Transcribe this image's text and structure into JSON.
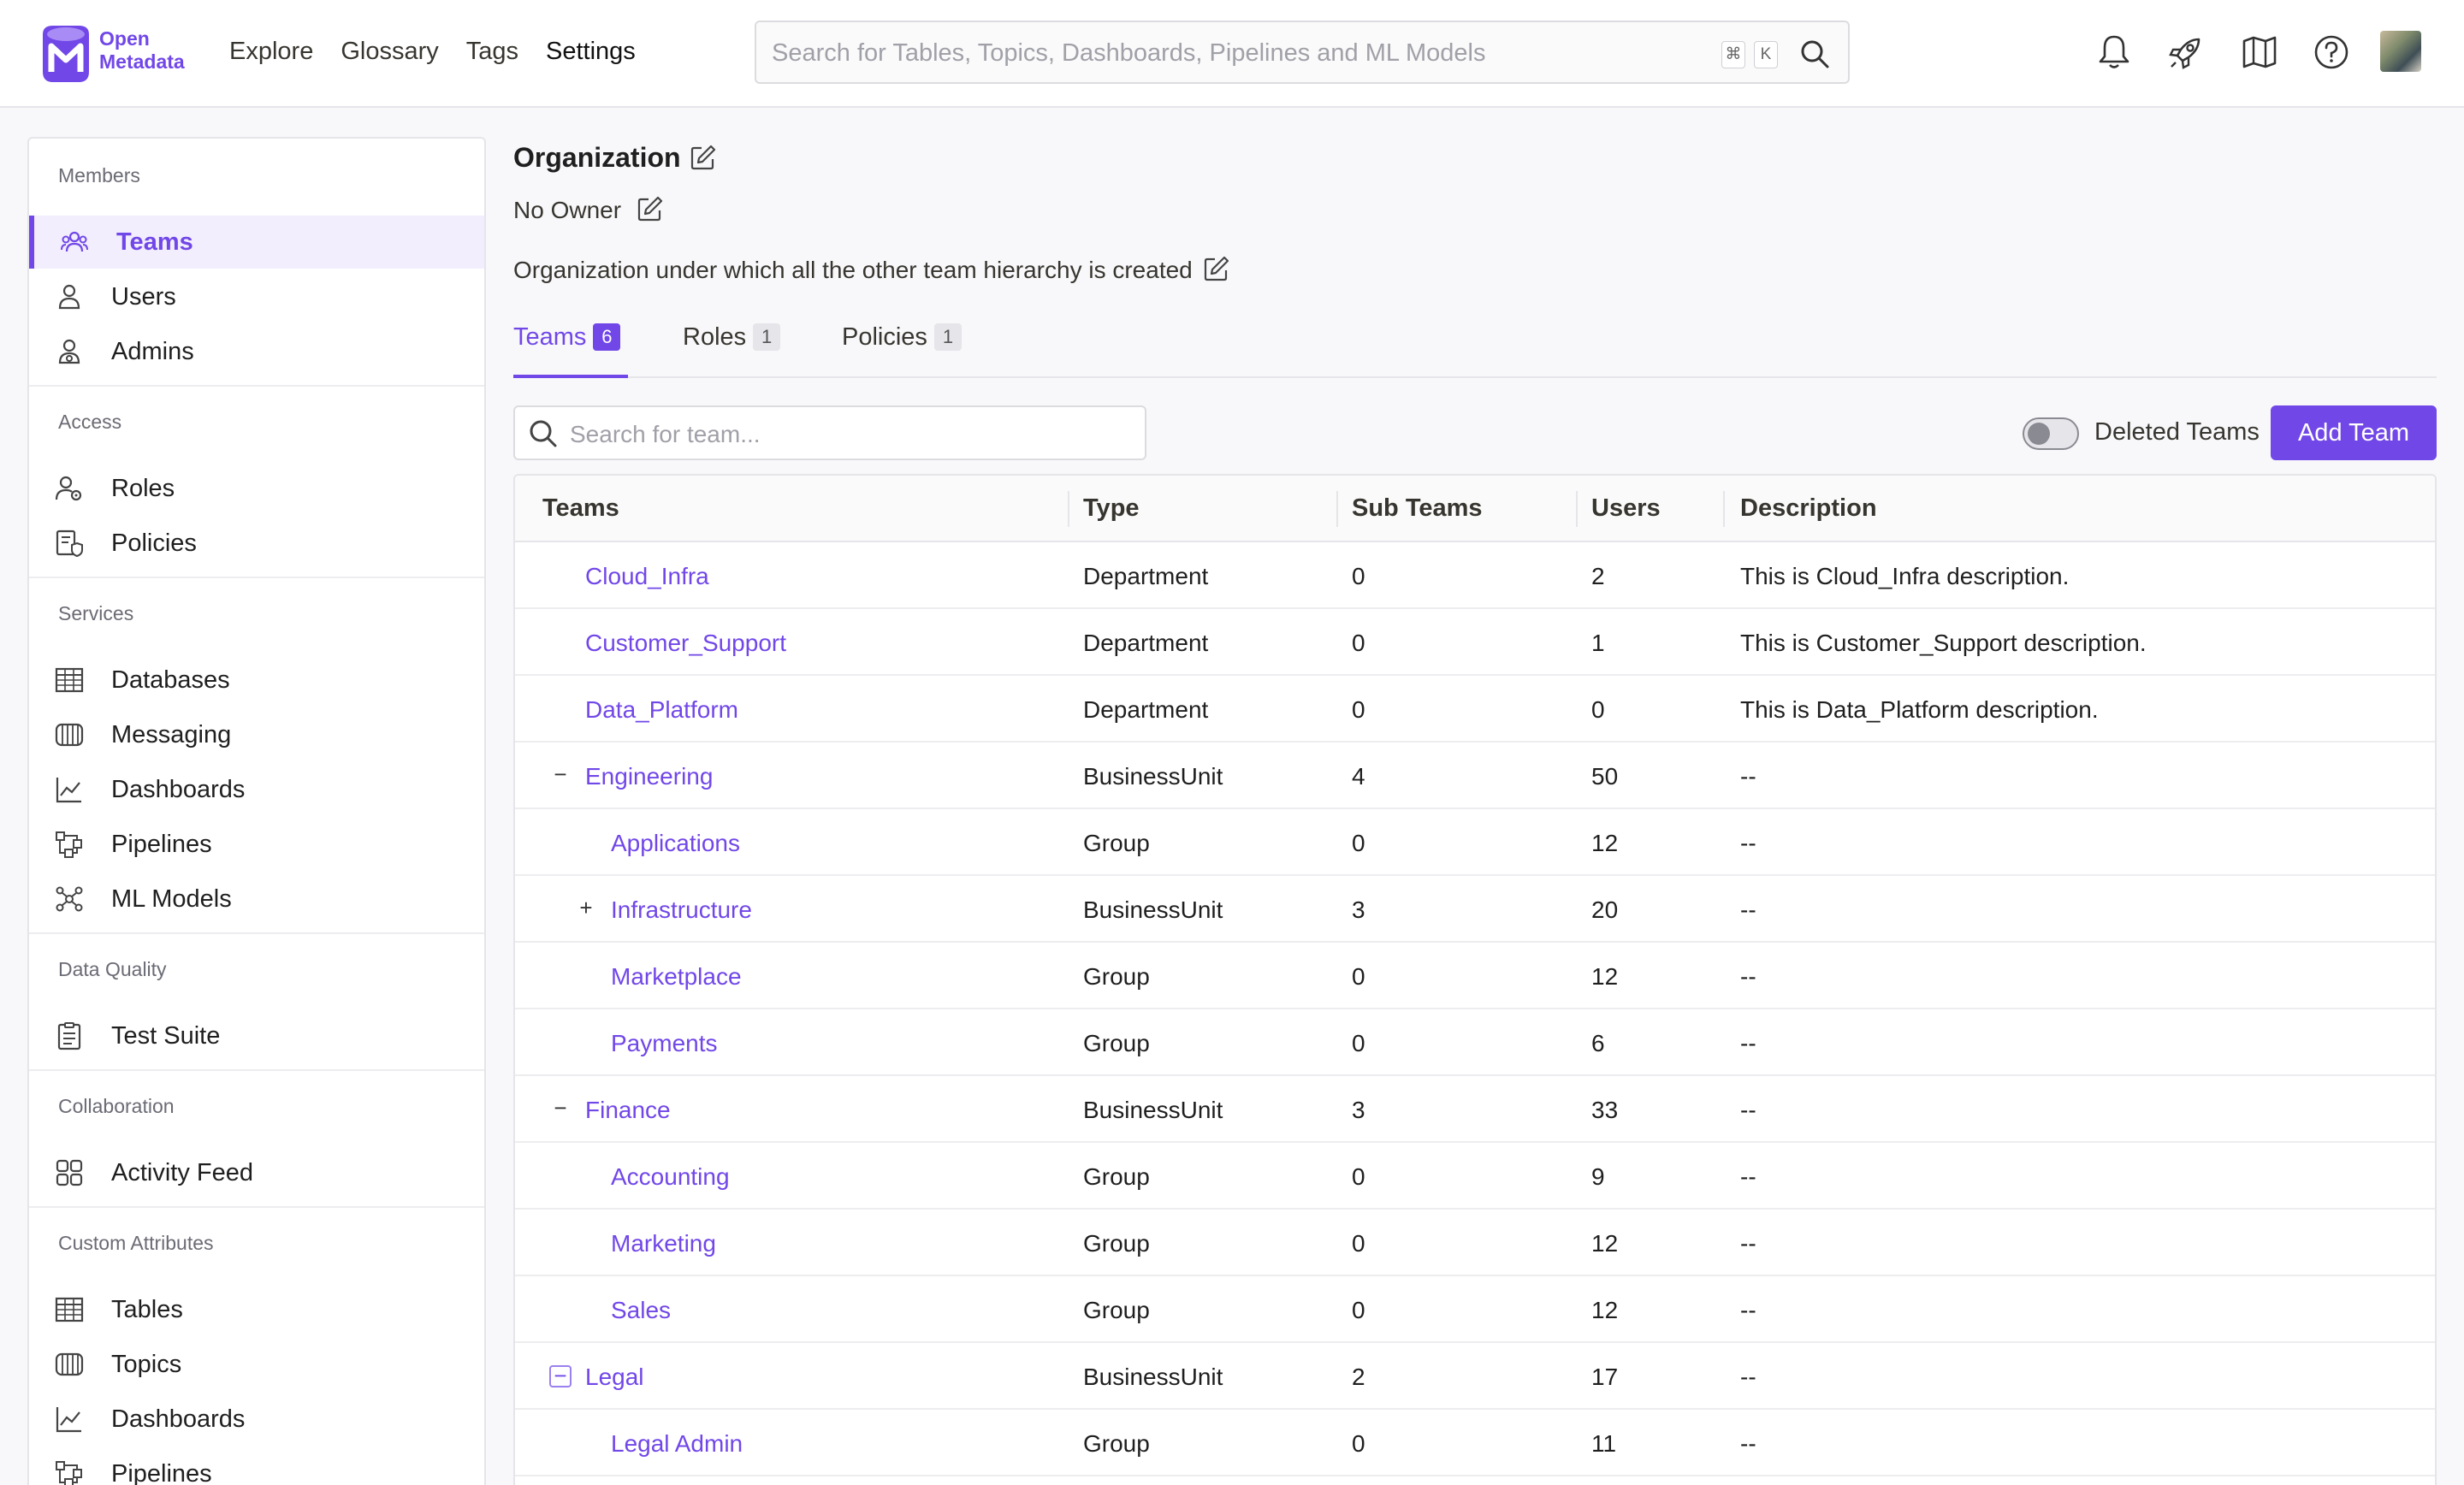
{
  "brand": {
    "line1": "Open",
    "line2": "Metadata",
    "color": "#7147e8"
  },
  "nav": [
    {
      "label": "Explore"
    },
    {
      "label": "Glossary"
    },
    {
      "label": "Tags"
    },
    {
      "label": "Settings"
    }
  ],
  "search": {
    "placeholder": "Search for Tables, Topics, Dashboards, Pipelines and ML Models",
    "shortcut_cmd": "⌘",
    "shortcut_key": "K"
  },
  "top_icons": [
    "bell-icon",
    "rocket-icon",
    "map-icon",
    "help-icon"
  ],
  "sidebar": {
    "sections": [
      {
        "title": "Members",
        "items": [
          {
            "label": "Teams",
            "icon": "teams-icon",
            "active": true
          },
          {
            "label": "Users",
            "icon": "user-icon"
          },
          {
            "label": "Admins",
            "icon": "admin-icon"
          }
        ]
      },
      {
        "title": "Access",
        "items": [
          {
            "label": "Roles",
            "icon": "roles-icon"
          },
          {
            "label": "Policies",
            "icon": "policies-icon"
          }
        ]
      },
      {
        "title": "Services",
        "items": [
          {
            "label": "Databases",
            "icon": "table-icon"
          },
          {
            "label": "Messaging",
            "icon": "topic-icon"
          },
          {
            "label": "Dashboards",
            "icon": "chart-icon"
          },
          {
            "label": "Pipelines",
            "icon": "pipeline-icon"
          },
          {
            "label": "ML Models",
            "icon": "mlmodel-icon"
          }
        ]
      },
      {
        "title": "Data Quality",
        "items": [
          {
            "label": "Test Suite",
            "icon": "testsuite-icon"
          }
        ]
      },
      {
        "title": "Collaboration",
        "items": [
          {
            "label": "Activity Feed",
            "icon": "feed-icon"
          }
        ]
      },
      {
        "title": "Custom Attributes",
        "items": [
          {
            "label": "Tables",
            "icon": "table-icon"
          },
          {
            "label": "Topics",
            "icon": "topic-icon"
          },
          {
            "label": "Dashboards",
            "icon": "chart-icon"
          },
          {
            "label": "Pipelines",
            "icon": "pipeline-icon"
          }
        ]
      }
    ]
  },
  "page": {
    "title": "Organization",
    "owner": "No Owner",
    "description": "Organization under which all the other team hierarchy is created"
  },
  "tabs": [
    {
      "label": "Teams",
      "count": "6",
      "active": true
    },
    {
      "label": "Roles",
      "count": "1"
    },
    {
      "label": "Policies",
      "count": "1"
    }
  ],
  "toolbar": {
    "search_placeholder": "Search for team...",
    "deleted_label": "Deleted Teams",
    "add_label": "Add Team"
  },
  "table": {
    "columns": [
      "Teams",
      "Type",
      "Sub Teams",
      "Users",
      "Description"
    ],
    "rows": [
      {
        "name": "Cloud_Infra",
        "type": "Department",
        "sub": "0",
        "users": "2",
        "desc": "This is Cloud_Infra description.",
        "level": 0,
        "expander": ""
      },
      {
        "name": "Customer_Support",
        "type": "Department",
        "sub": "0",
        "users": "1",
        "desc": "This is Customer_Support description.",
        "level": 0,
        "expander": ""
      },
      {
        "name": "Data_Platform",
        "type": "Department",
        "sub": "0",
        "users": "0",
        "desc": "This is Data_Platform description.",
        "level": 0,
        "expander": ""
      },
      {
        "name": "Engineering",
        "type": "BusinessUnit",
        "sub": "4",
        "users": "50",
        "desc": "--",
        "level": 0,
        "expander": "−"
      },
      {
        "name": "Applications",
        "type": "Group",
        "sub": "0",
        "users": "12",
        "desc": "--",
        "level": 1,
        "expander": ""
      },
      {
        "name": "Infrastructure",
        "type": "BusinessUnit",
        "sub": "3",
        "users": "20",
        "desc": "--",
        "level": 1,
        "expander": "+"
      },
      {
        "name": "Marketplace",
        "type": "Group",
        "sub": "0",
        "users": "12",
        "desc": "--",
        "level": 1,
        "expander": ""
      },
      {
        "name": "Payments",
        "type": "Group",
        "sub": "0",
        "users": "6",
        "desc": "--",
        "level": 1,
        "expander": ""
      },
      {
        "name": "Finance",
        "type": "BusinessUnit",
        "sub": "3",
        "users": "33",
        "desc": "--",
        "level": 0,
        "expander": "−"
      },
      {
        "name": "Accounting",
        "type": "Group",
        "sub": "0",
        "users": "9",
        "desc": "--",
        "level": 1,
        "expander": ""
      },
      {
        "name": "Marketing",
        "type": "Group",
        "sub": "0",
        "users": "12",
        "desc": "--",
        "level": 1,
        "expander": ""
      },
      {
        "name": "Sales",
        "type": "Group",
        "sub": "0",
        "users": "12",
        "desc": "--",
        "level": 1,
        "expander": ""
      },
      {
        "name": "Legal",
        "type": "BusinessUnit",
        "sub": "2",
        "users": "17",
        "desc": "--",
        "level": 0,
        "expander": "−",
        "expander_boxed": true
      },
      {
        "name": "Legal Admin",
        "type": "Group",
        "sub": "0",
        "users": "11",
        "desc": "--",
        "level": 1,
        "expander": ""
      }
    ]
  }
}
